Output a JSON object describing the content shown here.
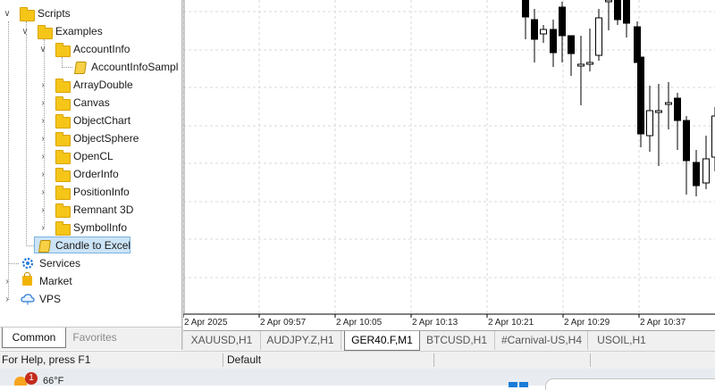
{
  "navigator": {
    "items": [
      {
        "label": "Scripts",
        "icon": "scripts-folder-icon",
        "expanded": true
      },
      {
        "label": "Examples",
        "icon": "folder-icon",
        "expanded": true
      },
      {
        "label": "AccountInfo",
        "icon": "folder-icon",
        "expanded": true
      },
      {
        "label": "AccountInfoSampl",
        "icon": "script-icon"
      },
      {
        "label": "ArrayDouble",
        "icon": "folder-icon"
      },
      {
        "label": "Canvas",
        "icon": "folder-icon"
      },
      {
        "label": "ObjectChart",
        "icon": "folder-icon"
      },
      {
        "label": "ObjectSphere",
        "icon": "folder-icon"
      },
      {
        "label": "OpenCL",
        "icon": "folder-icon"
      },
      {
        "label": "OrderInfo",
        "icon": "folder-icon"
      },
      {
        "label": "PositionInfo",
        "icon": "folder-icon"
      },
      {
        "label": "Remnant 3D",
        "icon": "folder-icon"
      },
      {
        "label": "SymbolInfo",
        "icon": "folder-icon"
      },
      {
        "label": "Candle to Excel",
        "icon": "script-icon",
        "selected": true
      },
      {
        "label": "Services",
        "icon": "gear-icon"
      },
      {
        "label": "Market",
        "icon": "market-bag-icon"
      },
      {
        "label": "VPS",
        "icon": "cloud-icon"
      }
    ],
    "tabs": [
      {
        "label": "Common",
        "active": true
      },
      {
        "label": "Favorites",
        "active": false
      }
    ]
  },
  "chart": {
    "time_labels": [
      "2 Apr 2025",
      "2 Apr 09:57",
      "2 Apr 10:05",
      "2 Apr 10:13",
      "2 Apr 10:21",
      "2 Apr 10:29",
      "2 Apr 10:37"
    ],
    "tabs": [
      {
        "label": "XAUUSD,H1",
        "active": false
      },
      {
        "label": "AUDJPY.Z,H1",
        "active": false
      },
      {
        "label": "GER40.F,M1",
        "active": true
      },
      {
        "label": "BTCUSD,H1",
        "active": false
      },
      {
        "label": "#Carnival-US,H4",
        "active": false
      },
      {
        "label": "USOIL,H1",
        "active": false
      }
    ],
    "colors": {
      "bull": "#ffffff",
      "bear": "#000000",
      "grid": "#d8d8d8",
      "wick": "#000000"
    }
  },
  "statusbar": {
    "help_text": "For Help, press F1",
    "profile": "Default"
  },
  "taskbar": {
    "temperature": "66°F",
    "notification_count": "1"
  }
}
